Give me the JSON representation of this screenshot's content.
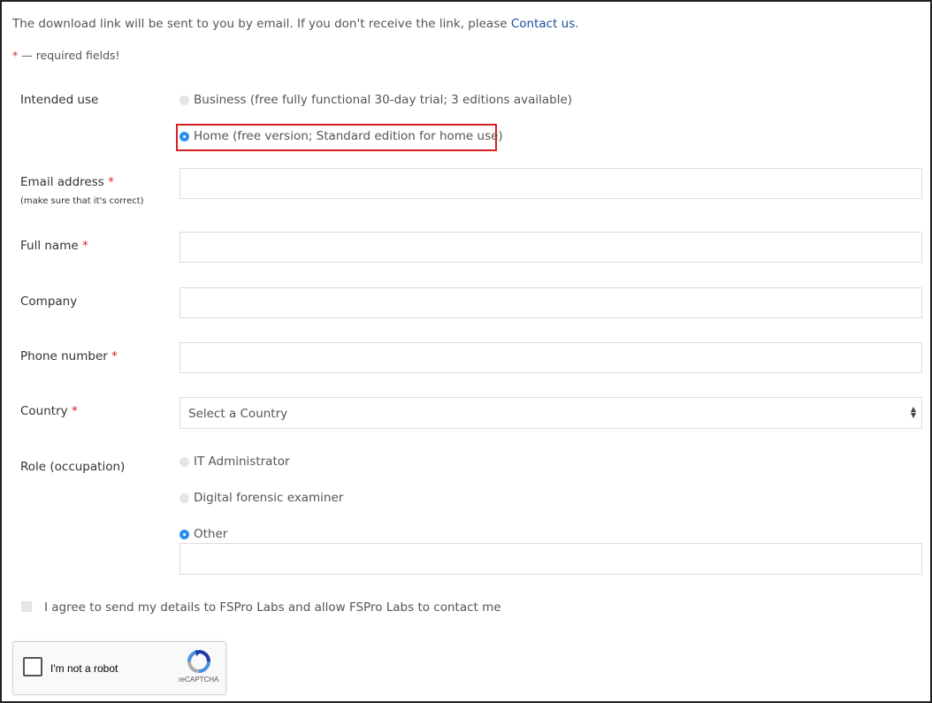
{
  "intro": {
    "text": "The download link will be sent to you by email. If you don't receive the link, please ",
    "link": "Contact us",
    "end": "."
  },
  "required_note": {
    "star": "*",
    "text": " — required fields!"
  },
  "intended_use": {
    "label": "Intended use",
    "options": [
      {
        "label": "Business (free fully functional 30-day trial; 3 editions available)",
        "checked": false
      },
      {
        "label": "Home (free version; Standard edition for home use)",
        "checked": true
      }
    ]
  },
  "email": {
    "label": "Email address",
    "required": "*",
    "hint": "(make sure that it's correct)",
    "value": ""
  },
  "full_name": {
    "label": "Full name",
    "required": "*",
    "value": ""
  },
  "company": {
    "label": "Company",
    "value": ""
  },
  "phone": {
    "label": "Phone number",
    "required": "*",
    "value": ""
  },
  "country": {
    "label": "Country",
    "required": "*",
    "selected": "Select a Country"
  },
  "role": {
    "label": "Role (occupation)",
    "options": [
      {
        "label": "IT Administrator",
        "checked": false
      },
      {
        "label": "Digital forensic examiner",
        "checked": false
      },
      {
        "label": "Other",
        "checked": true
      }
    ],
    "other_value": ""
  },
  "agree": {
    "text": "I agree to send my details to FSPro Labs and allow FSPro Labs to contact me",
    "checked": false
  },
  "captcha": {
    "label": "I'm not a robot",
    "brand": "reCAPTCHA",
    "icon": "recaptcha-logo-icon"
  },
  "colors": {
    "accent": "#2c8df0",
    "required": "#d22222",
    "link": "#1a4f9c",
    "highlight": "#d71f1f"
  }
}
